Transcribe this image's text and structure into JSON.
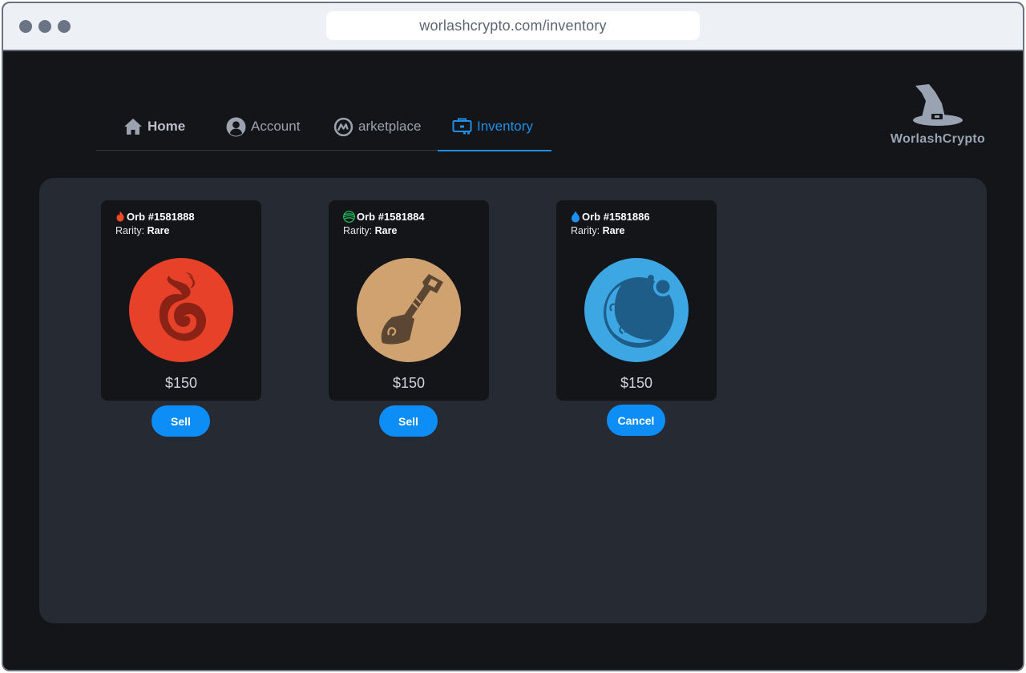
{
  "browser": {
    "url": "worlashcrypto.com/inventory"
  },
  "nav": {
    "items": [
      {
        "label": "Home",
        "icon": "home-icon"
      },
      {
        "label": "Account",
        "icon": "account-icon"
      },
      {
        "label": "arketplace",
        "icon": "coinmarketcap-icon"
      },
      {
        "label": "Inventory",
        "icon": "inventory-icon",
        "active": true
      }
    ]
  },
  "brand": {
    "name": "WorlashCrypto",
    "logo_icon": "wizard-hat-icon"
  },
  "colors": {
    "accent": "#1f8fe8",
    "button": "#0d8ef7",
    "fire": "#e8412a",
    "earth": "#cfa26f",
    "water": "#3da7e4"
  },
  "inventory": {
    "cards": [
      {
        "title": "Orb #1581888",
        "element_icon": "fire-icon",
        "rarity_label": "Rarity:",
        "rarity": "Rare",
        "image": "fire-orb-icon",
        "price": "$150",
        "action": "Sell"
      },
      {
        "title": "Orb #1581884",
        "element_icon": "earth-icon",
        "rarity_label": "Rarity:",
        "rarity": "Rare",
        "image": "shovel-orb-icon",
        "price": "$150",
        "action": "Sell"
      },
      {
        "title": "Orb #1581886",
        "element_icon": "water-drop-icon",
        "rarity_label": "Rarity:",
        "rarity": "Rare",
        "image": "water-orb-icon",
        "price": "$150",
        "action": "Cancel"
      }
    ]
  }
}
